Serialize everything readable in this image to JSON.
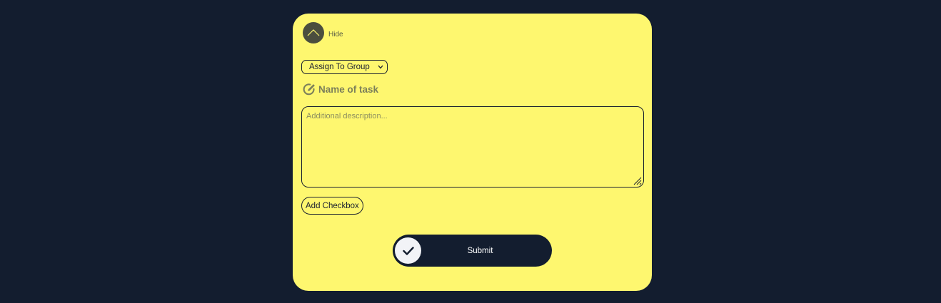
{
  "header": {
    "hide_label": "Hide"
  },
  "form": {
    "group_select": {
      "selected": "Assign To Group"
    },
    "task_name": "Name of task",
    "description": {
      "placeholder": "Additional description..."
    },
    "add_checkbox_label": "Add Checkbox",
    "submit_label": "Submit"
  },
  "colors": {
    "page_background": "#131d2f",
    "card_background": "#fef76f",
    "submit_background": "#131d2f"
  }
}
